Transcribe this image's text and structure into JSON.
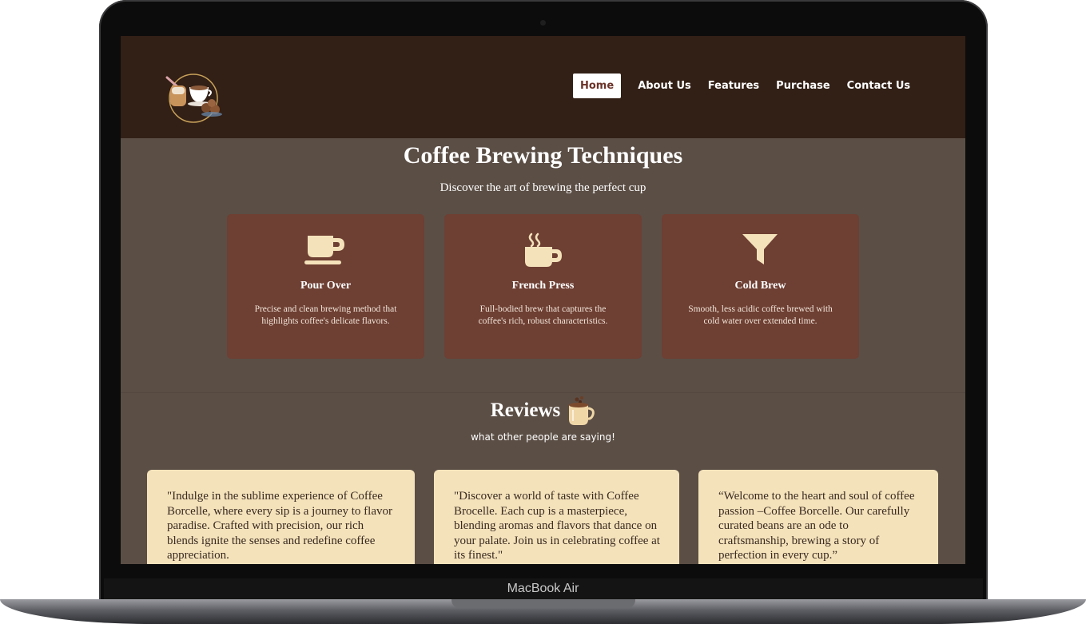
{
  "device": {
    "brand_label": "MacBook Air"
  },
  "nav": {
    "items": [
      {
        "label": "Home",
        "active": true
      },
      {
        "label": "About Us",
        "active": false
      },
      {
        "label": "Features",
        "active": false
      },
      {
        "label": "Purchase",
        "active": false
      },
      {
        "label": "Contact Us",
        "active": false
      }
    ]
  },
  "hero": {
    "title": "Coffee Brewing Techniques",
    "subtitle": "Discover the art of brewing the perfect cup"
  },
  "techniques": [
    {
      "icon": "mug-saucer-icon",
      "title": "Pour Over",
      "description": "Precise and clean brewing method that highlights coffee's delicate flavors."
    },
    {
      "icon": "hot-mug-icon",
      "title": "French Press",
      "description": "Full-bodied brew that captures the coffee's rich, robust characteristics."
    },
    {
      "icon": "filter-funnel-icon",
      "title": "Cold Brew",
      "description": "Smooth, less acidic coffee brewed with cold water over extended time."
    }
  ],
  "reviews": {
    "title": "Reviews",
    "subtitle": "what other people are saying!",
    "items": [
      {
        "text": "\"Indulge in the sublime experience of Coffee Borcelle, where every sip is a journey to flavor paradise. Crafted with precision, our rich blends ignite the senses and redefine coffee appreciation."
      },
      {
        "text": "\"Discover a world of taste with Coffee Brocelle. Each cup is a masterpiece, blending aromas and flavors that dance on your palate. Join us in celebrating coffee at its finest.\""
      },
      {
        "text": "“Welcome to the heart and soul of coffee passion –Coffee Borcelle. Our carefully curated beans are an ode to craftsmanship, brewing a story of perfection in every cup.”"
      }
    ]
  },
  "colors": {
    "header_bg": "#321f15",
    "page_bg": "#5b4e45",
    "card_bg": "#6e3f33",
    "icon_color": "#f4e2bb",
    "review_bg": "#f4e2bb",
    "active_nav_text": "#6b3329"
  }
}
